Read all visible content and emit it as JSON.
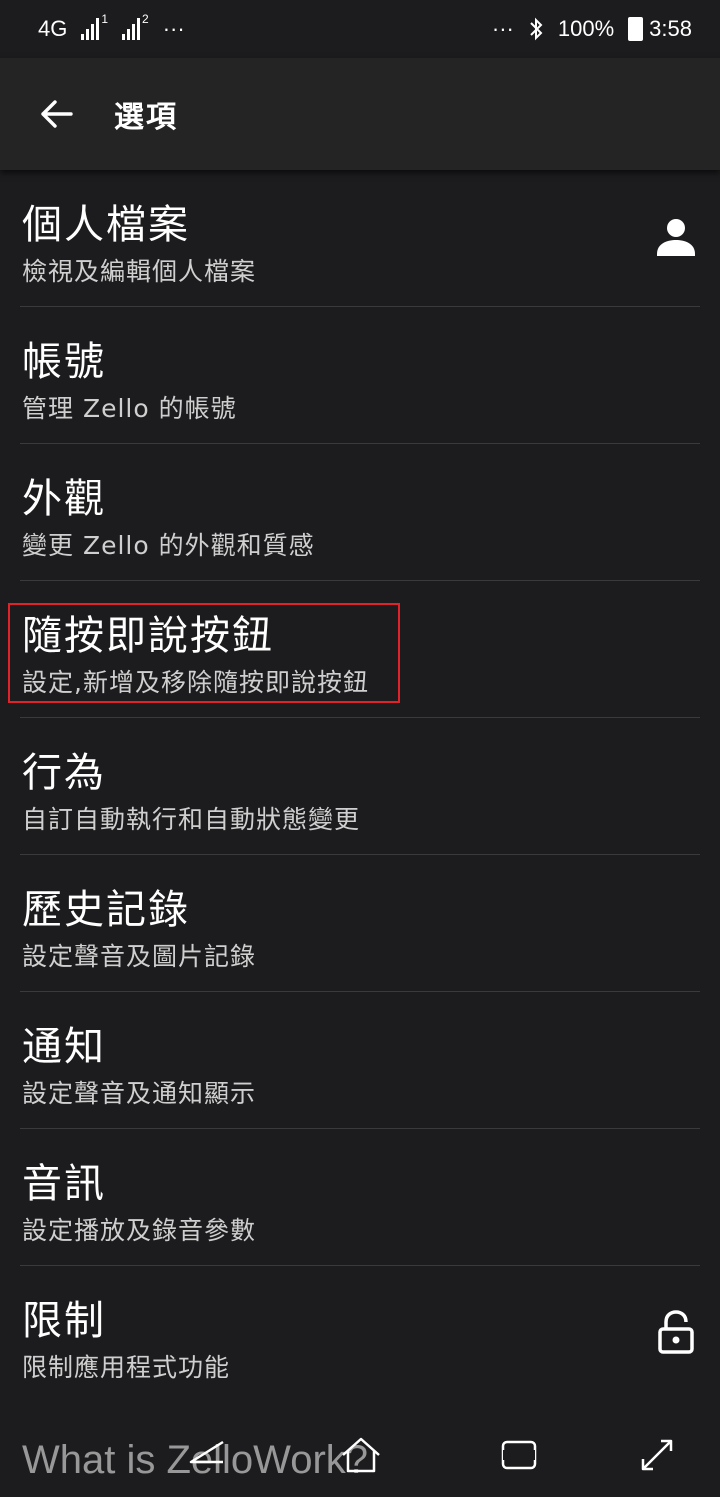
{
  "status_bar": {
    "network": "4G",
    "sim1": "1",
    "sim2": "2",
    "more_left": "···",
    "more_right": "···",
    "battery": "100%",
    "time": "3:58"
  },
  "app_bar": {
    "title": "選項",
    "back_icon": "arrow-left-icon"
  },
  "items": [
    {
      "title": "個人檔案",
      "subtitle": "檢視及編輯個人檔案",
      "icon": "person-icon"
    },
    {
      "title": "帳號",
      "subtitle": "管理 Zello 的帳號"
    },
    {
      "title": "外觀",
      "subtitle": "變更 Zello 的外觀和質感"
    },
    {
      "title": "隨按即說按鈕",
      "subtitle": "設定,新增及移除隨按即說按鈕"
    },
    {
      "title": "行為",
      "subtitle": "自訂自動執行和自動狀態變更"
    },
    {
      "title": "歷史記錄",
      "subtitle": "設定聲音及圖片記錄"
    },
    {
      "title": "通知",
      "subtitle": "設定聲音及通知顯示"
    },
    {
      "title": "音訊",
      "subtitle": "設定播放及錄音參數"
    },
    {
      "title": "限制",
      "subtitle": "限制應用程式功能",
      "icon": "lock-icon"
    }
  ],
  "watermark": "What is ZelloWork?",
  "colors": {
    "background": "#1c1c1e",
    "app_bar": "#242424",
    "highlight": "#e0232b",
    "subtitle": "#cfcfcf"
  }
}
